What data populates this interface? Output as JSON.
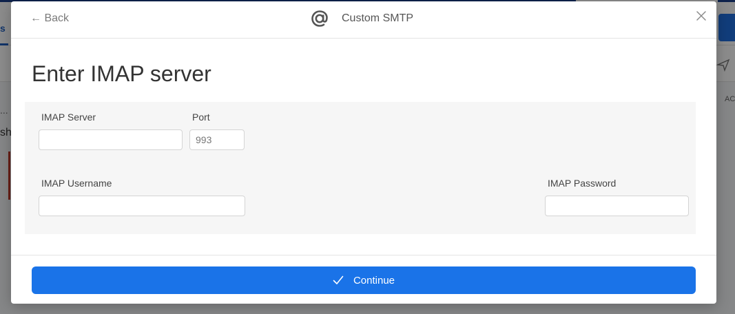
{
  "background": {
    "tab_label": "s",
    "row_dots": "...",
    "side_text": "sh",
    "col_label": "AC"
  },
  "modal": {
    "back_label": "← Back",
    "header_title": "Custom SMTP",
    "header_icon": "at-icon",
    "close_icon": "close-icon",
    "page_title": "Enter IMAP server",
    "fields": {
      "imap_server": {
        "label": "IMAP Server",
        "value": "",
        "placeholder": ""
      },
      "port": {
        "label": "Port",
        "value": "",
        "placeholder": "993"
      },
      "imap_username": {
        "label": "IMAP Username",
        "value": "",
        "placeholder": ""
      },
      "imap_password": {
        "label": "IMAP Password",
        "value": "",
        "placeholder": ""
      }
    },
    "continue_label": "Continue",
    "continue_icon": "check-icon"
  },
  "colors": {
    "primary": "#1a73e8",
    "panel_bg": "#f6f6f6",
    "text": "#333333"
  }
}
